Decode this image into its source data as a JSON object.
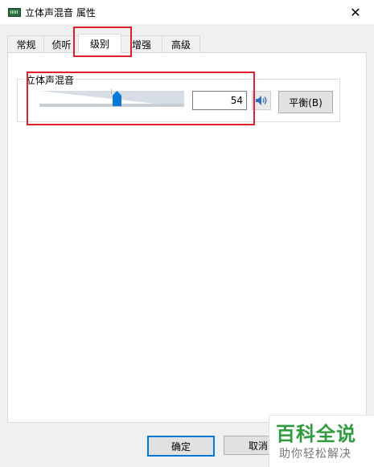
{
  "window": {
    "title": "立体声混音 属性",
    "icon": "sound-device-icon",
    "close_glyph": "✕"
  },
  "tabs": [
    {
      "label": "常规",
      "active": false
    },
    {
      "label": "侦听",
      "active": false
    },
    {
      "label": "级别",
      "active": true
    },
    {
      "label": "增强",
      "active": false
    },
    {
      "label": "高级",
      "active": false
    }
  ],
  "levels": {
    "group_title": "立体声混音",
    "slider_value": 54,
    "level_value": "54",
    "speaker_icon": "speaker-icon",
    "balance_label": "平衡(B)"
  },
  "footer": {
    "ok_label": "确定",
    "cancel_label": "取消"
  },
  "watermark": {
    "main": "百科全说",
    "sub": "助你轻松解决"
  },
  "colors": {
    "accent": "#0078d7",
    "annotation": "#e0212b",
    "watermark": "#2e9c3e"
  }
}
